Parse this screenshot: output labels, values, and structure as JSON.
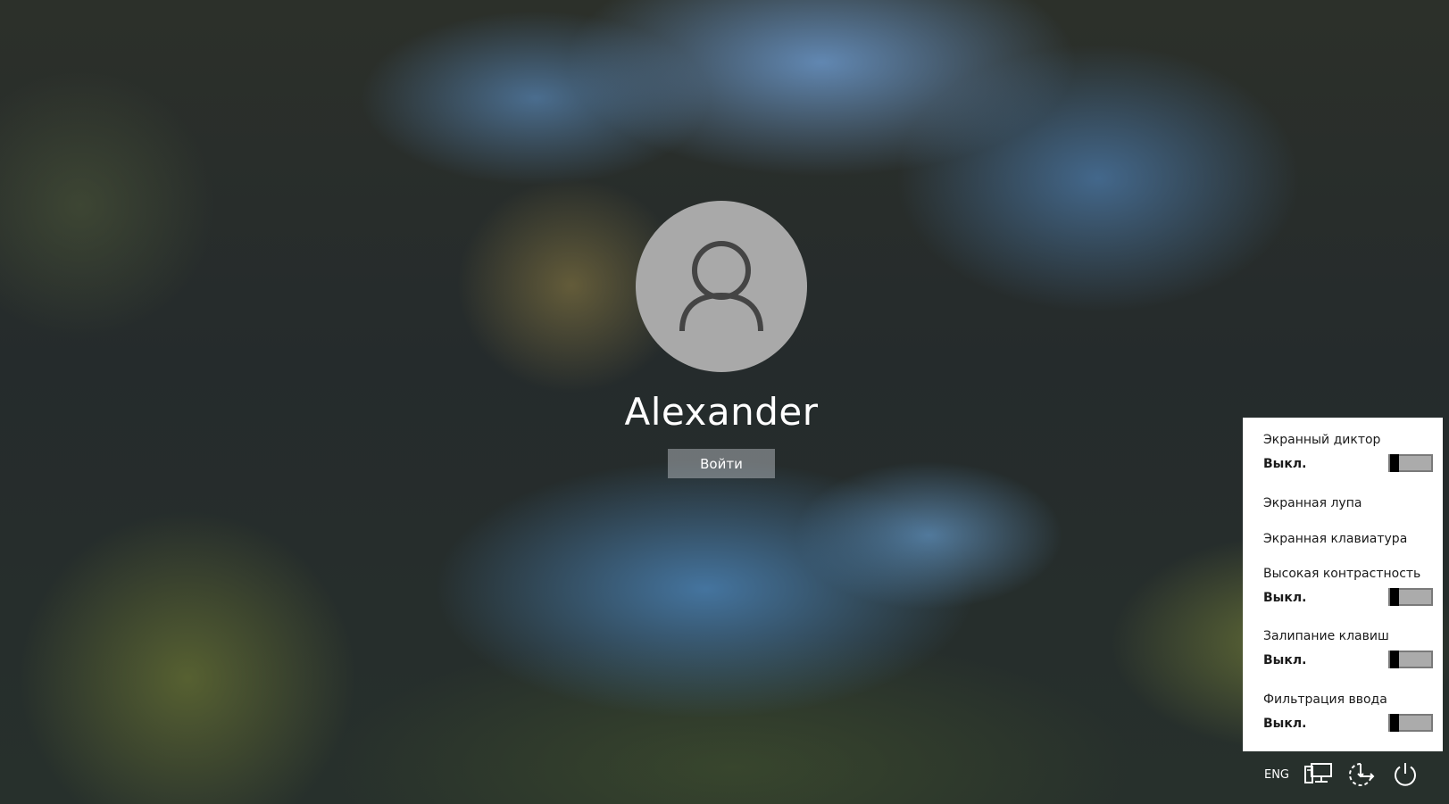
{
  "user": {
    "name": "Alexander",
    "sign_in_label": "Войти"
  },
  "accessibility_menu": {
    "options": [
      {
        "label": "Экранный диктор",
        "state": "Выкл.",
        "has_toggle": true,
        "on": false
      },
      {
        "label": "Экранная лупа",
        "has_toggle": false
      },
      {
        "label": "Экранная клавиатура",
        "has_toggle": false
      },
      {
        "label": "Высокая контрастность",
        "state": "Выкл.",
        "has_toggle": true,
        "on": false
      },
      {
        "label": "Залипание клавиш",
        "state": "Выкл.",
        "has_toggle": true,
        "on": false
      },
      {
        "label": "Фильтрация ввода",
        "state": "Выкл.",
        "has_toggle": true,
        "on": false
      }
    ]
  },
  "system_tray": {
    "language": "ENG",
    "icons": [
      "network-icon",
      "ease-of-access-icon",
      "power-icon"
    ]
  },
  "colors": {
    "avatar_bg": "#a9a9a9",
    "panel_bg": "#ffffff",
    "toggle_knob": "#000000",
    "toggle_track": "#ababab"
  }
}
